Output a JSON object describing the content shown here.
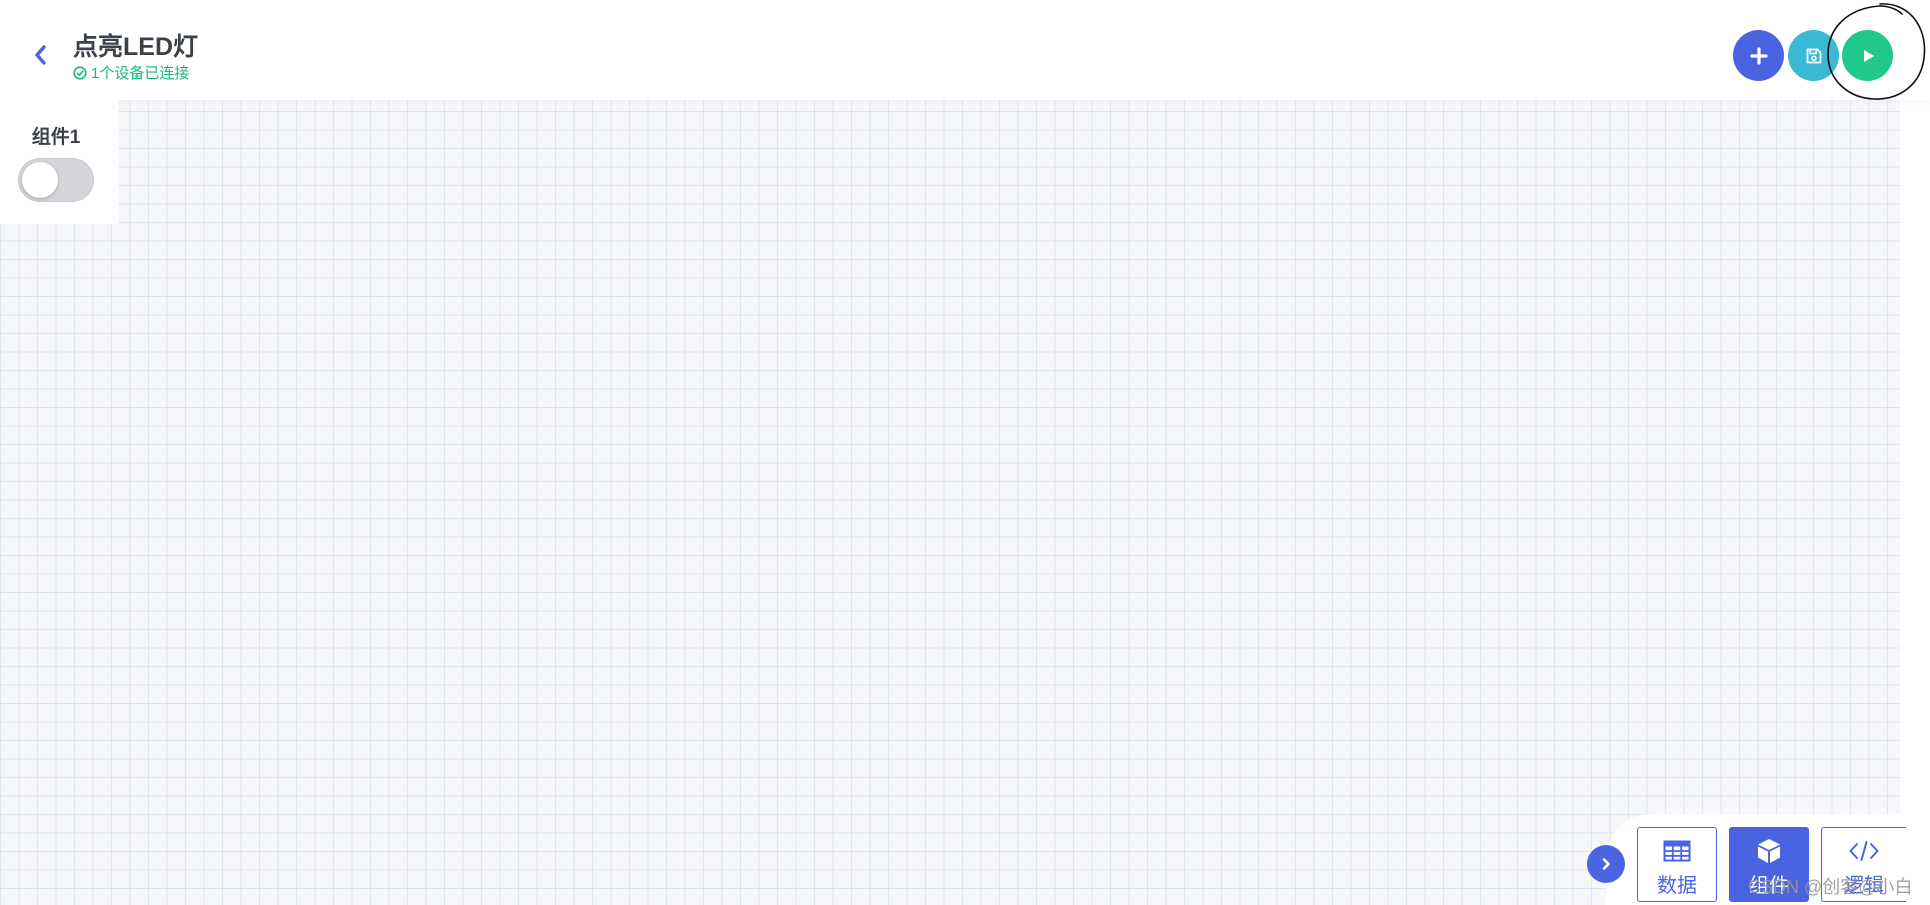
{
  "header": {
    "title": "点亮LED灯",
    "status": "1个设备已连接",
    "back_icon": "chevron-left-icon",
    "actions": [
      {
        "name": "add",
        "icon": "plus-icon",
        "color": "#4a63e0"
      },
      {
        "name": "save",
        "icon": "save-icon",
        "color": "#3bb9d4"
      },
      {
        "name": "run",
        "icon": "play-icon",
        "color": "#1fc98b"
      }
    ]
  },
  "canvas": {
    "widgets": [
      {
        "label": "组件1",
        "type": "switch",
        "state": "off"
      }
    ]
  },
  "bottom_toolbar": {
    "collapse_icon": "chevron-right-icon",
    "tabs": [
      {
        "label": "数据",
        "icon": "table-icon",
        "active": false
      },
      {
        "label": "组件",
        "icon": "cube-icon",
        "active": true
      },
      {
        "label": "逻辑",
        "icon": "code-icon",
        "active": false
      }
    ]
  },
  "watermark": "CSDN @创客@小白",
  "colors": {
    "primary": "#4a63e0",
    "success": "#19b97a",
    "save": "#3bb9d4",
    "run": "#1fc98b"
  }
}
